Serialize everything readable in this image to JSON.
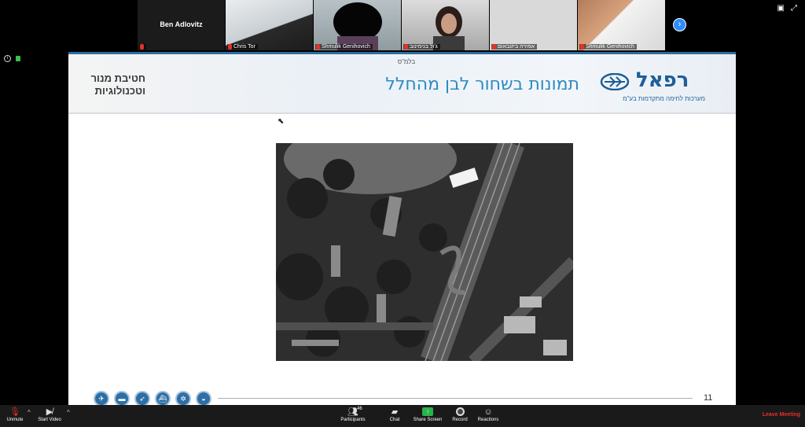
{
  "gallery": {
    "participants": [
      {
        "name": "Ben Adlovitz",
        "video": false
      },
      {
        "name": "Chris Tor",
        "video": true
      },
      {
        "name": "Shmulik Genihovich",
        "video": true
      },
      {
        "name": "ג'ול בנימינוב",
        "video": true
      },
      {
        "name": "אמירה ביזנבאום",
        "video": true
      },
      {
        "name": "Shmulik Genihovich",
        "video": true
      }
    ],
    "next_icon": "chevron-right-icon"
  },
  "slide": {
    "classification": "בלמ\"ס",
    "title": "תמונות בשחור לבן מהחלל",
    "club_name": "חטיבת מנור וטכנולוגיות",
    "logo_word": "רפאל",
    "logo_tagline": "מערכות לחימה מתקדמות בע\"מ",
    "page_number": "11",
    "footer_icons": [
      "aircraft-icon",
      "tank-icon",
      "missile-icon",
      "ship-icon",
      "satellite-icon",
      "vehicle-icon"
    ]
  },
  "toolbar": {
    "unmute": "Unmute",
    "start_video": "Start Video",
    "participants": "Participants",
    "participant_count": "46",
    "chat": "Chat",
    "share_screen": "Share Screen",
    "record": "Record",
    "reactions": "Reactions",
    "leave": "Leave Meeting"
  },
  "colors": {
    "slide_title": "#2f8ac1",
    "brand_blue": "#1d5f98",
    "leave_red": "#e5302a",
    "share_green": "#2bb24c",
    "zoom_blue": "#2d8cff"
  }
}
